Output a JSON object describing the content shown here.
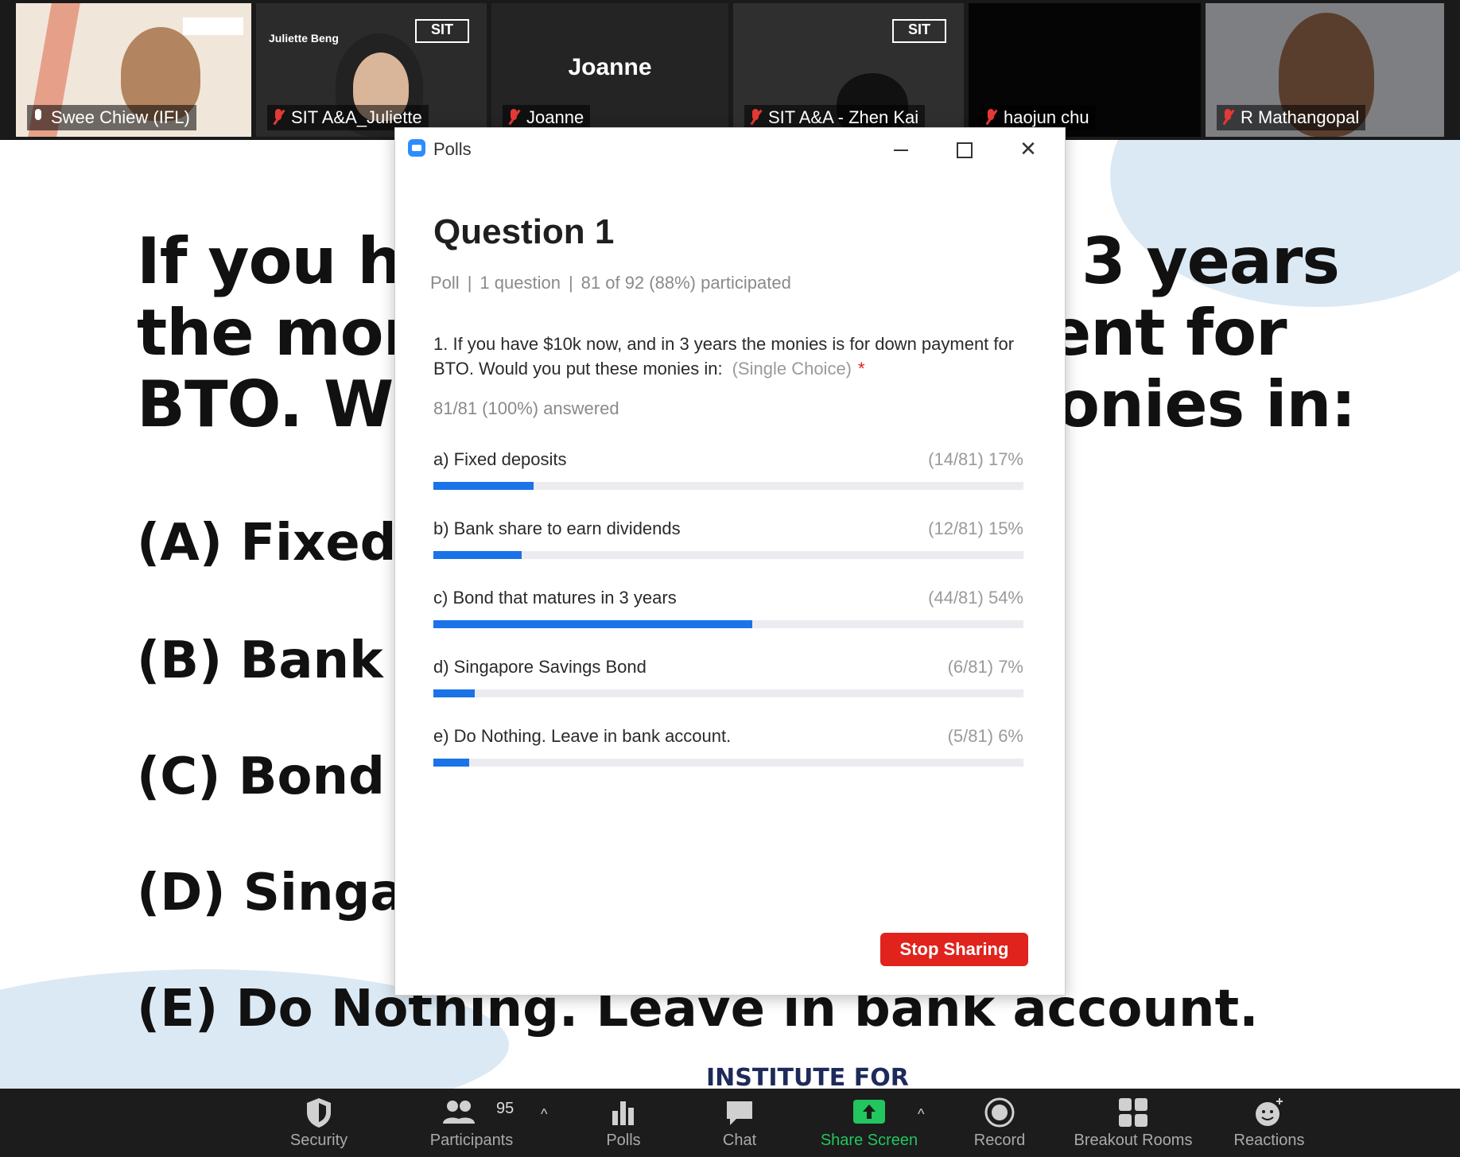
{
  "participants": [
    {
      "name": "Swee Chiew (IFL)",
      "muted": false
    },
    {
      "name": "SIT A&A_Juliette",
      "muted": true,
      "tile_caption": "Juliette Beng"
    },
    {
      "name": "Joanne",
      "muted": true,
      "center_name": "Joanne"
    },
    {
      "name": "SIT A&A - Zhen Kai",
      "muted": true
    },
    {
      "name": "haojun chu",
      "muted": true
    },
    {
      "name": "R Mathangopal",
      "muted": true
    }
  ],
  "slide": {
    "question_lines": [
      {
        "left": "If you ha",
        "right": "3 years"
      },
      {
        "left": "the mon",
        "right": "ent for"
      },
      {
        "left": "BTO. W",
        "right": "onies in:"
      }
    ],
    "options": [
      "(A) Fixed d",
      "(B) Bank sh",
      "(C) Bond th",
      "(D) Singap",
      "(E) Do Nothing. Leave in bank account."
    ],
    "footer_logo": "INSTITUTE FOR"
  },
  "polls_window": {
    "title": "Polls",
    "question_title": "Question 1",
    "meta": {
      "type": "Poll",
      "count": "1 question",
      "participation": "81 of 92 (88%) participated"
    },
    "question_text": "1. If you have $10k now, and in 3 years the monies is for down payment for BTO. Would you put these monies in:",
    "choice_type": "(Single Choice)",
    "required_mark": "*",
    "answered": "81/81 (100%) answered",
    "options": [
      {
        "label": "a) Fixed deposits",
        "count": "(14/81) 17%",
        "percent": 17
      },
      {
        "label": "b) Bank share to earn dividends",
        "count": "(12/81) 15%",
        "percent": 15
      },
      {
        "label": "c) Bond that matures in 3 years",
        "count": "(44/81) 54%",
        "percent": 54
      },
      {
        "label": "d) Singapore Savings Bond",
        "count": "(6/81) 7%",
        "percent": 7
      },
      {
        "label": "e) Do Nothing. Leave in bank account.",
        "count": "(5/81) 6%",
        "percent": 6
      }
    ],
    "stop_sharing": "Stop Sharing"
  },
  "toolbar": {
    "security": "Security",
    "participants": "Participants",
    "participant_count": "95",
    "polls": "Polls",
    "chat": "Chat",
    "share_screen": "Share Screen",
    "record": "Record",
    "breakout_rooms": "Breakout Rooms",
    "reactions": "Reactions"
  },
  "colors": {
    "accent": "#1a73e8",
    "stop": "#e0231d",
    "share": "#22c55e",
    "toolbar": "#1c1c1c"
  }
}
